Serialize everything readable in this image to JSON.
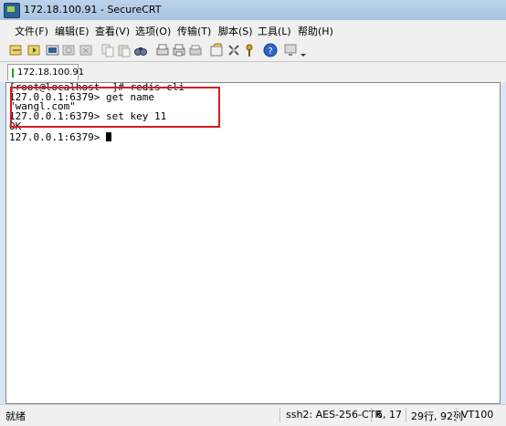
{
  "window": {
    "title": "172.18.100.91 - SecureCRT"
  },
  "menubar": [
    "文件(F)",
    "编辑(E)",
    "查看(V)",
    "选项(O)",
    "传输(T)",
    "脚本(S)",
    "工具(L)",
    "帮助(H)"
  ],
  "tab": {
    "label": "172.18.100.91"
  },
  "terminal": {
    "lines": [
      "[root@localhost ~]# redis-cli",
      "127.0.0.1:6379> get name",
      "\"wangl.com\"",
      "127.0.0.1:6379> set key 11",
      "OK",
      "127.0.0.1:6379> "
    ]
  },
  "status": {
    "ready": "就绪",
    "cipher": "ssh2: AES-256-CTR",
    "cursor_pos": "6,  17",
    "size": "29行, 92列",
    "terminal_type": "VT100"
  },
  "colors": {
    "highlight": "#d21d22",
    "titlebar": "#a9c4e2"
  },
  "icons": [
    "connect-icon",
    "quick-connect-icon",
    "connect-tab-icon",
    "reconnect-icon",
    "disconnect-icon",
    "copy-icon",
    "paste-icon",
    "find-icon",
    "print-setup-icon",
    "print-icon",
    "print-screen-icon",
    "session-options-icon",
    "global-options-icon",
    "keymap-icon",
    "help-icon",
    "monitor-icon"
  ]
}
